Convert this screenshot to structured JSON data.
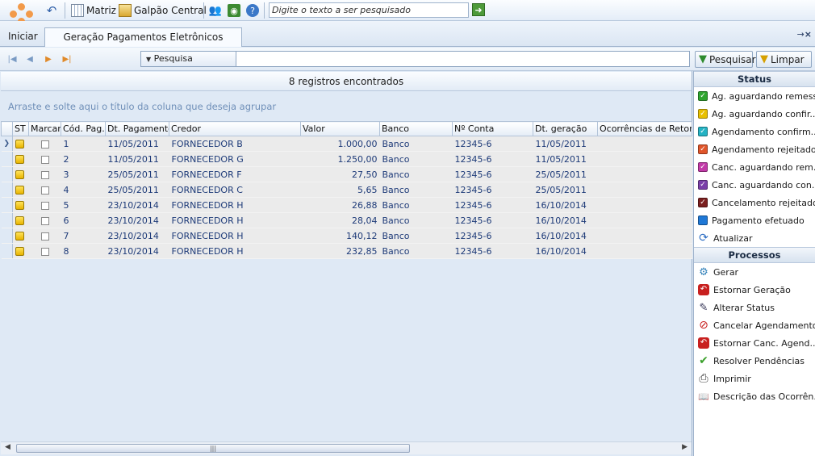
{
  "toolbar": {
    "matriz_label": "Matriz",
    "galpao_label": "Galpão Central",
    "search_placeholder": "Digite o texto a ser pesquisado"
  },
  "tabs": {
    "home_label": "Iniciar",
    "active_label": "Geração Pagamentos Eletrônicos"
  },
  "navbar": {
    "filter_label": "Pesquisa",
    "search_button": "Pesquisar",
    "clear_button": "Limpar"
  },
  "grid": {
    "record_count": "8 registros encontrados",
    "group_hint": "Arraste e solte aqui o título da coluna que deseja agrupar",
    "columns": [
      "ST",
      "Marcar",
      "Cód. Pag.",
      "Dt. Pagamento",
      "Credor",
      "Valor",
      "Banco",
      "Nº Conta",
      "Dt. geração",
      "Ocorrências de Retorno"
    ],
    "rows": [
      {
        "cod": "1",
        "dt_pag": "11/05/2011",
        "credor": "FORNECEDOR B",
        "valor": "1.000,00",
        "banco": "Banco",
        "conta": "12345-6",
        "dt_ger": "11/05/2011"
      },
      {
        "cod": "2",
        "dt_pag": "11/05/2011",
        "credor": "FORNECEDOR G",
        "valor": "1.250,00",
        "banco": "Banco",
        "conta": "12345-6",
        "dt_ger": "11/05/2011"
      },
      {
        "cod": "3",
        "dt_pag": "25/05/2011",
        "credor": "FORNECEDOR F",
        "valor": "27,50",
        "banco": "Banco",
        "conta": "12345-6",
        "dt_ger": "25/05/2011"
      },
      {
        "cod": "4",
        "dt_pag": "25/05/2011",
        "credor": "FORNECEDOR C",
        "valor": "5,65",
        "banco": "Banco",
        "conta": "12345-6",
        "dt_ger": "25/05/2011"
      },
      {
        "cod": "5",
        "dt_pag": "23/10/2014",
        "credor": "FORNECEDOR H",
        "valor": "26,88",
        "banco": "Banco",
        "conta": "12345-6",
        "dt_ger": "16/10/2014"
      },
      {
        "cod": "6",
        "dt_pag": "23/10/2014",
        "credor": "FORNECEDOR H",
        "valor": "28,04",
        "banco": "Banco",
        "conta": "12345-6",
        "dt_ger": "16/10/2014"
      },
      {
        "cod": "7",
        "dt_pag": "23/10/2014",
        "credor": "FORNECEDOR H",
        "valor": "140,12",
        "banco": "Banco",
        "conta": "12345-6",
        "dt_ger": "16/10/2014"
      },
      {
        "cod": "8",
        "dt_pag": "23/10/2014",
        "credor": "FORNECEDOR H",
        "valor": "232,85",
        "banco": "Banco",
        "conta": "12345-6",
        "dt_ger": "16/10/2014"
      }
    ]
  },
  "side": {
    "status_title": "Status",
    "status_items": [
      {
        "label": "Ag. aguardando remessa",
        "color": "#2fa52f"
      },
      {
        "label": "Ag. aguardando confir...",
        "color": "#e8c000"
      },
      {
        "label": "Agendamento confirm...",
        "color": "#24b3c4"
      },
      {
        "label": "Agendamento rejeitado",
        "color": "#e0552a"
      },
      {
        "label": "Canc. aguardando rem...",
        "color": "#c23aa8"
      },
      {
        "label": "Canc. aguardando con...",
        "color": "#7a3fa8"
      },
      {
        "label": "Cancelamento rejeitado",
        "color": "#7a1e1e"
      },
      {
        "label": "Pagamento efetuado",
        "color": "#1f78d6"
      }
    ],
    "refresh_label": "Atualizar",
    "process_title": "Processos",
    "process_items": [
      {
        "label": "Gerar",
        "icon": "generate-icon"
      },
      {
        "label": "Estornar Geração",
        "icon": "undo-red-icon"
      },
      {
        "label": "Alterar Status",
        "icon": "edit-icon"
      },
      {
        "label": "Cancelar Agendamento",
        "icon": "cancel-icon"
      },
      {
        "label": "Estornar Canc. Agend...",
        "icon": "undo-red-icon"
      },
      {
        "label": "Resolver Pendências",
        "icon": "check-icon"
      },
      {
        "label": "Imprimir",
        "icon": "printer-icon"
      },
      {
        "label": "Descrição das Ocorrên...",
        "icon": "book-icon"
      }
    ]
  }
}
